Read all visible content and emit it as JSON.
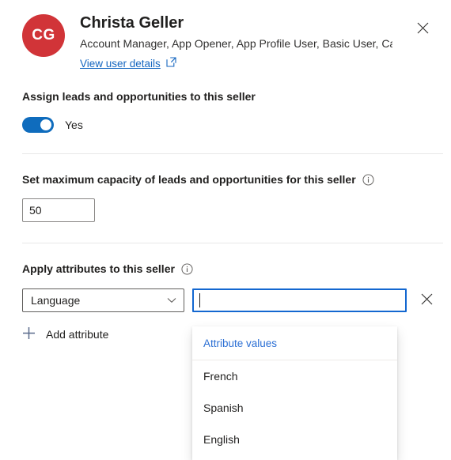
{
  "header": {
    "avatar_initials": "CG",
    "avatar_color": "#d13438",
    "user_name": "Christa Geller",
    "user_roles": "Account Manager, App Opener, App Profile User, Basic User, Car...",
    "details_link": "View user details",
    "details_link_icon": "external-link-icon",
    "close_icon": "close-icon"
  },
  "assign_section": {
    "label": "Assign leads and opportunities to this seller",
    "toggle_value": "Yes",
    "toggle_on": true,
    "toggle_color": "#0f6cbd"
  },
  "capacity_section": {
    "label": "Set maximum capacity of leads and opportunities for this seller",
    "info_icon": "info-icon",
    "value": "50",
    "placeholder": ""
  },
  "attributes_section": {
    "label": "Apply attributes to this seller",
    "info_icon": "info-icon",
    "attribute_select": {
      "value": "Language",
      "chevron_icon": "chevron-down-icon"
    },
    "attribute_value_input": {
      "value": "",
      "placeholder": "",
      "focused": true,
      "focus_color": "#1367d0"
    },
    "clear_icon": "close-icon",
    "add_attribute": {
      "label": "Add attribute",
      "icon": "plus-icon",
      "icon_color": "#5a6b8c"
    }
  },
  "dropdown": {
    "header": "Attribute values",
    "header_color": "#2b6fd4",
    "items": [
      {
        "label": "French"
      },
      {
        "label": "Spanish"
      },
      {
        "label": "English"
      }
    ]
  }
}
